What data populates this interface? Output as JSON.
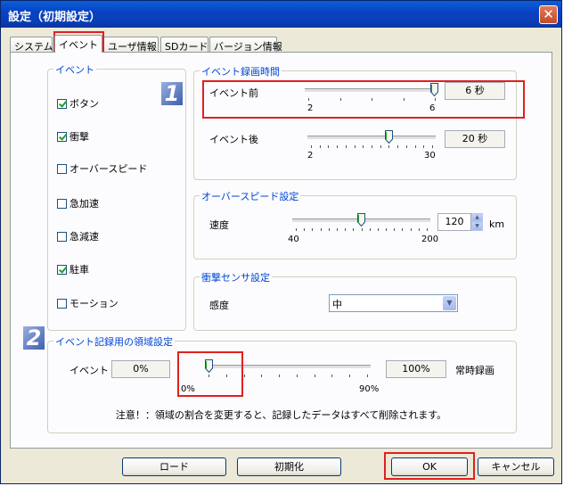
{
  "window": {
    "title": "設定（初期設定）",
    "close_glyph": "✕"
  },
  "tabs": [
    {
      "label": "システム"
    },
    {
      "label": "イベント",
      "active": true
    },
    {
      "label": "ユーザ情報"
    },
    {
      "label": "SDカード"
    },
    {
      "label": "バージョン情報"
    }
  ],
  "event_group": {
    "title": "イベント",
    "items": [
      {
        "label": "ボタン",
        "checked": true
      },
      {
        "label": "衝撃",
        "checked": true
      },
      {
        "label": "オーバースピード",
        "checked": false
      },
      {
        "label": "急加速",
        "checked": false
      },
      {
        "label": "急減速",
        "checked": false
      },
      {
        "label": "駐車",
        "checked": true
      },
      {
        "label": "モーション",
        "checked": false
      }
    ]
  },
  "badges": {
    "one": "1",
    "two": "2"
  },
  "recording_time": {
    "title": "イベント録画時間",
    "before": {
      "label": "イベント前",
      "value": "6 秒",
      "min": "2",
      "max": "6",
      "level": 6,
      "min_value": 2,
      "max_value": 6
    },
    "after": {
      "label": "イベント後",
      "value": "20 秒",
      "min": "2",
      "max": "30",
      "level": 20,
      "min_value": 2,
      "max_value": 30
    }
  },
  "overspeed": {
    "title": "オーバースピード設定",
    "speed_label": "速度",
    "value": "120",
    "unit": "km",
    "min": "40",
    "max": "200",
    "level": 120,
    "min_value": 40,
    "max_value": 200
  },
  "shock_sensor": {
    "title": "衝撃センサ設定",
    "label": "感度",
    "selected": "中"
  },
  "region": {
    "title": "イベント記録用の領域設定",
    "event_label": "イベント",
    "event_value": "0%",
    "constant_value": "100%",
    "constant_label": "常時録画",
    "min": "0%",
    "max": "90%",
    "level": 0,
    "notice": "注意！：領域の割合を変更すると、記録したデータはすべて削除されます。"
  },
  "buttons": {
    "load": "ロード",
    "reset": "初期化",
    "ok": "OK",
    "cancel": "キャンセル"
  }
}
